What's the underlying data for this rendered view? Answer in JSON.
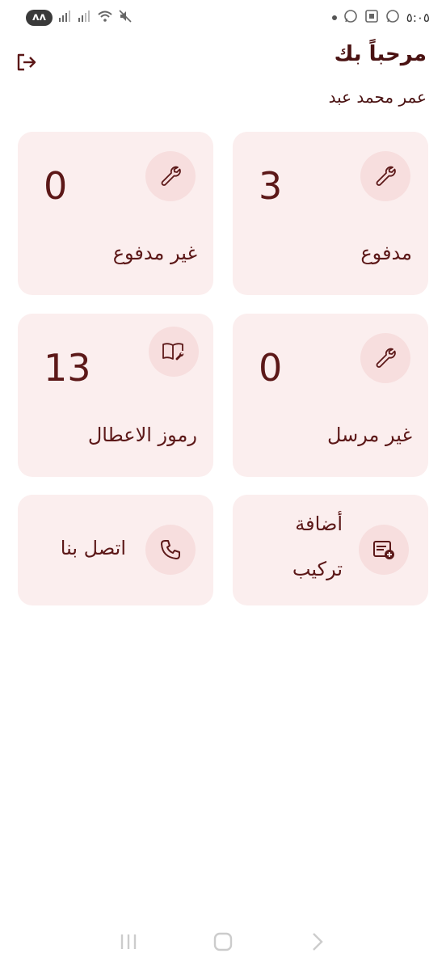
{
  "status_bar": {
    "notification_badge": "ᴧᴧ",
    "time": "٥:٠٥"
  },
  "header": {
    "welcome": "مرحباً بك",
    "username": "عمر محمد عبد"
  },
  "cards": [
    {
      "label": "مدفوع",
      "count": "3",
      "icon": "wrench-icon"
    },
    {
      "label": "غير مدفوع",
      "count": "0",
      "icon": "wrench-icon"
    },
    {
      "label": "غير مرسل",
      "count": "0",
      "icon": "wrench-icon"
    },
    {
      "label": "رموز الاعطال",
      "count": "13",
      "icon": "book-wrench-icon"
    }
  ],
  "actions": [
    {
      "line1": "أضافة",
      "line2": "تركيب",
      "icon": "add-form-icon"
    },
    {
      "label": "اتصل بنا",
      "icon": "phone-icon"
    }
  ],
  "colors": {
    "accent": "#5c1818",
    "card_bg": "#fbeeee",
    "icon_bg": "#f7dede"
  }
}
